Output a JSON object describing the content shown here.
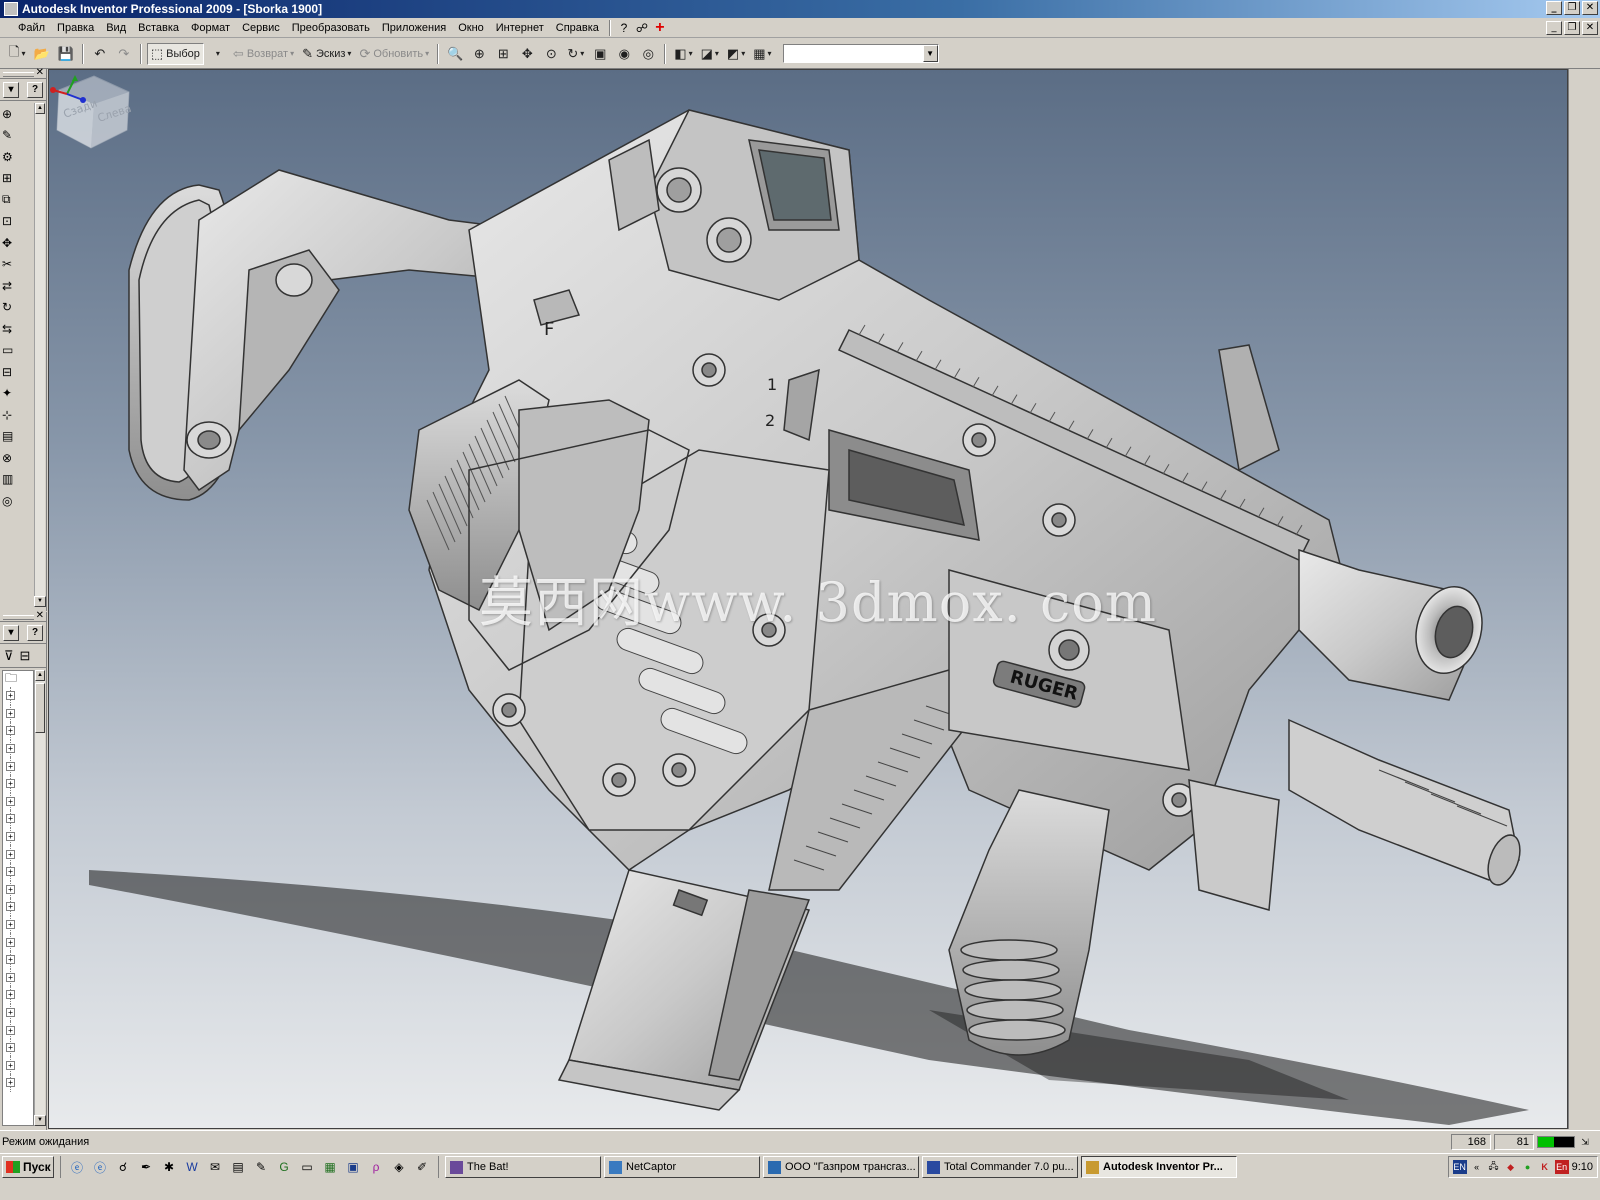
{
  "window": {
    "title": "Autodesk Inventor Professional 2009 - [Sborka 1900]"
  },
  "menu": {
    "items": [
      "Файл",
      "Правка",
      "Вид",
      "Вставка",
      "Формат",
      "Сервис",
      "Преобразовать",
      "Приложения",
      "Окно",
      "Интернет",
      "Справка"
    ]
  },
  "toolbar": {
    "select_label": "Выбор",
    "return_label": "Возврат",
    "sketch_label": "Эскиз",
    "update_label": "Обновить",
    "combo_value": ""
  },
  "panel": {
    "tool_icons": [
      "assembly-place-icon",
      "create-component-icon",
      "pattern-icon",
      "mirror-icon",
      "copy-icon",
      "constraint-icon",
      "grip-icon",
      "repair-icon",
      "move-icon",
      "rotate-icon",
      "replace-icon",
      "section-icon",
      "plane-icon",
      "point-icon",
      "ucs-icon",
      "bom-icon",
      "weld-icon",
      "frame-icon",
      "tube-icon"
    ]
  },
  "viewport": {
    "watermark": "莫西网www. 3dmox. com",
    "viewcube_faces": [
      "Сзади",
      "Слева"
    ],
    "brand_label": "RUGER",
    "selector_marks": [
      "F",
      "1",
      "2"
    ]
  },
  "status": {
    "text": "Режим ожидания",
    "field1": "168",
    "field2": "81",
    "meter_fraction": 0.45
  },
  "taskbar": {
    "start_label": "Пуск",
    "tasks": [
      {
        "label": "The Bat!",
        "active": false
      },
      {
        "label": "NetCaptor",
        "active": false
      },
      {
        "label": "ООО \"Газпром трансгаз...",
        "active": false
      },
      {
        "label": "Total Commander 7.0 pu...",
        "active": false
      },
      {
        "label": "Autodesk Inventor Pr...",
        "active": true
      }
    ],
    "tray_lang_left": "EN",
    "tray_lang_right": "En",
    "clock": "9:10"
  }
}
